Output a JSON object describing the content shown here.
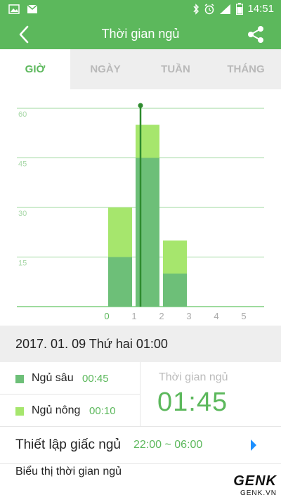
{
  "status_bar": {
    "time": "14:51",
    "icons": [
      "image-icon",
      "gmail-icon",
      "bluetooth-icon",
      "alarm-icon",
      "signal-icon",
      "battery-icon"
    ]
  },
  "header": {
    "title": "Thời gian ngủ",
    "background": "#5cb85c"
  },
  "tabs": [
    {
      "label": "GIỜ",
      "active": true
    },
    {
      "label": "NGÀY",
      "active": false
    },
    {
      "label": "TUẦN",
      "active": false
    },
    {
      "label": "THÁNG",
      "active": false
    }
  ],
  "chart_data": {
    "type": "bar",
    "stacked": true,
    "categories": [
      "0",
      "1",
      "2",
      "3",
      "4",
      "5"
    ],
    "yticks": [
      15,
      30,
      45,
      60
    ],
    "ylim": [
      0,
      60
    ],
    "grid": true,
    "series": [
      {
        "name": "Ngủ sâu",
        "color": "#6dbf78",
        "values": [
          15,
          45,
          10,
          0,
          0,
          0
        ]
      },
      {
        "name": "Ngủ nông",
        "color": "#a6e66d",
        "values": [
          15,
          10,
          10,
          0,
          0,
          0
        ]
      }
    ],
    "cursor_category": "1",
    "cursor_color": "#2e8b2e"
  },
  "selected": {
    "date": "2017. 01. 09 Thứ hai 01:00",
    "deep_label": "Ngủ sâu",
    "deep_value": "00:45",
    "light_label": "Ngủ nông",
    "light_value": "00:10",
    "total_label": "Thời gian ngủ",
    "total_value": "01:45"
  },
  "settings": {
    "sleep_setting_label": "Thiết lập giấc ngủ",
    "sleep_setting_value": "22:00 ~ 06:00",
    "display_label": "Biểu thị thời gian ngủ"
  },
  "watermark": {
    "brand": "GENK",
    "sub": "GENK.VN"
  }
}
